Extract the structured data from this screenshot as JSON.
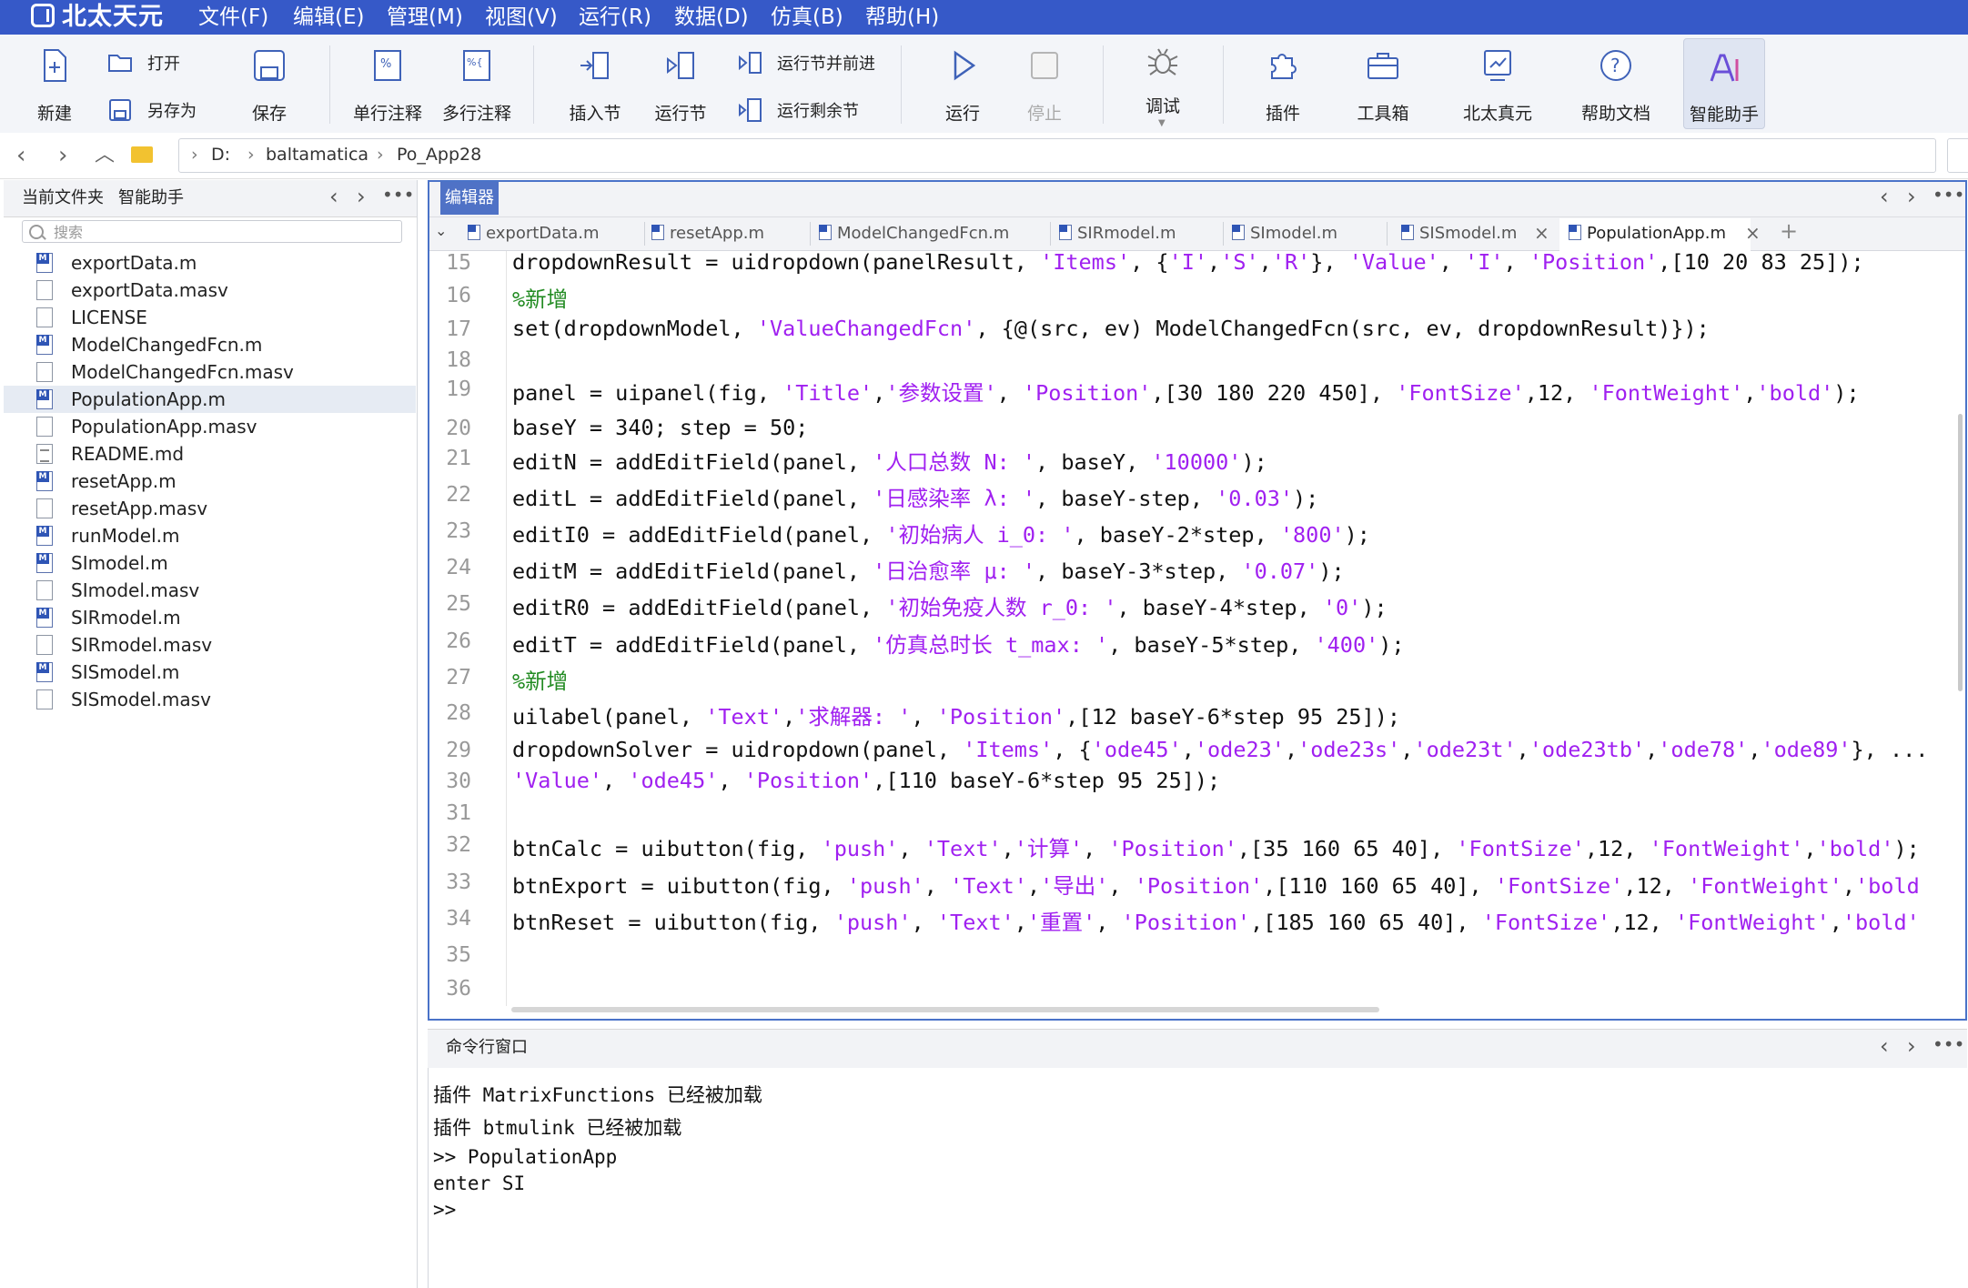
{
  "app": {
    "logo_text": "北太天元"
  },
  "menu": [
    "文件(F)",
    "编辑(E)",
    "管理(M)",
    "视图(V)",
    "运行(R)",
    "数据(D)",
    "仿真(B)",
    "帮助(H)"
  ],
  "toolbar": {
    "new": "新建",
    "open": "打开",
    "save_as": "另存为",
    "save": "保存",
    "comment_line": "单行注释",
    "comment_block": "多行注释",
    "insert_section": "插入节",
    "run_section": "运行节",
    "run_advance": "运行节并前进",
    "run_remaining": "运行剩余节",
    "run": "运行",
    "stop": "停止",
    "debug": "调试",
    "plugins": "插件",
    "toolbox": "工具箱",
    "beitai_zhenyuan": "北太真元",
    "help_docs": "帮助文档",
    "ai_assistant": "智能助手"
  },
  "address": {
    "crumbs": [
      "D:",
      "baltamatica",
      "Po_App28"
    ]
  },
  "left_panel": {
    "tabs": [
      "当前文件夹",
      "智能助手"
    ],
    "search_placeholder": "搜索",
    "files": [
      {
        "name": "exportData.m",
        "type": "m"
      },
      {
        "name": "exportData.masv",
        "type": "file"
      },
      {
        "name": "LICENSE",
        "type": "file"
      },
      {
        "name": "ModelChangedFcn.m",
        "type": "m"
      },
      {
        "name": "ModelChangedFcn.masv",
        "type": "file"
      },
      {
        "name": "PopulationApp.m",
        "type": "m",
        "selected": true
      },
      {
        "name": "PopulationApp.masv",
        "type": "file"
      },
      {
        "name": "README.md",
        "type": "md"
      },
      {
        "name": "resetApp.m",
        "type": "m"
      },
      {
        "name": "resetApp.masv",
        "type": "file"
      },
      {
        "name": "runModel.m",
        "type": "m"
      },
      {
        "name": "SImodel.m",
        "type": "m"
      },
      {
        "name": "SImodel.masv",
        "type": "file"
      },
      {
        "name": "SIRmodel.m",
        "type": "m"
      },
      {
        "name": "SIRmodel.masv",
        "type": "file"
      },
      {
        "name": "SISmodel.m",
        "type": "m"
      },
      {
        "name": "SISmodel.masv",
        "type": "file"
      }
    ]
  },
  "editor": {
    "title": "编辑器",
    "tabs": [
      "exportData.m",
      "resetApp.m",
      "ModelChangedFcn.m",
      "SIRmodel.m",
      "SImodel.m",
      "SISmodel.m",
      "PopulationApp.m"
    ],
    "active_tab": "PopulationApp.m",
    "lines": [
      {
        "n": "15",
        "t": "dropdownResult = uidropdown(panelResult, 'Items', {'I','S','R'}, 'Value', 'I', 'Position',[10 20 83 25]);"
      },
      {
        "n": "16",
        "t": "%新增"
      },
      {
        "n": "17",
        "t": "set(dropdownModel, 'ValueChangedFcn', {@(src, ev) ModelChangedFcn(src, ev, dropdownResult)});"
      },
      {
        "n": "18",
        "t": ""
      },
      {
        "n": "19",
        "t": "panel = uipanel(fig, 'Title','参数设置', 'Position',[30 180 220 450], 'FontSize',12, 'FontWeight','bold');"
      },
      {
        "n": "20",
        "t": "baseY = 340; step = 50;"
      },
      {
        "n": "21",
        "t": "editN = addEditField(panel, '人口总数 N: ', baseY, '10000');"
      },
      {
        "n": "22",
        "t": "editL = addEditField(panel, '日感染率 λ: ', baseY-step, '0.03');"
      },
      {
        "n": "23",
        "t": "editI0 = addEditField(panel, '初始病人 i_0: ', baseY-2*step, '800');"
      },
      {
        "n": "24",
        "t": "editM = addEditField(panel, '日治愈率 μ: ', baseY-3*step, '0.07');"
      },
      {
        "n": "25",
        "t": "editR0 = addEditField(panel, '初始免疫人数 r_0: ', baseY-4*step, '0');"
      },
      {
        "n": "26",
        "t": "editT = addEditField(panel, '仿真总时长 t_max: ', baseY-5*step, '400');"
      },
      {
        "n": "27",
        "t": "%新增"
      },
      {
        "n": "28",
        "t": "uilabel(panel, 'Text','求解器: ', 'Position',[12 baseY-6*step 95 25]);"
      },
      {
        "n": "29",
        "t": "dropdownSolver = uidropdown(panel, 'Items', {'ode45','ode23','ode23s','ode23t','ode23tb','ode78','ode89'}, ..."
      },
      {
        "n": "30",
        "t": "'Value', 'ode45', 'Position',[110 baseY-6*step 95 25]);"
      },
      {
        "n": "31",
        "t": ""
      },
      {
        "n": "32",
        "t": "btnCalc = uibutton(fig, 'push', 'Text','计算', 'Position',[35 160 65 40], 'FontSize',12, 'FontWeight','bold');"
      },
      {
        "n": "33",
        "t": "btnExport = uibutton(fig, 'push', 'Text','导出', 'Position',[110 160 65 40], 'FontSize',12, 'FontWeight','bold"
      },
      {
        "n": "34",
        "t": "btnReset = uibutton(fig, 'push', 'Text','重置', 'Position',[185 160 65 40], 'FontSize',12, 'FontWeight','bold'"
      },
      {
        "n": "35",
        "t": ""
      },
      {
        "n": "36",
        "t": ""
      }
    ]
  },
  "command_window": {
    "title": "命令行窗口",
    "lines": [
      "插件 MatrixFunctions 已经被加载",
      "插件 btmulink 已经被加载",
      ">> PopulationApp",
      "enter SI",
      ">>"
    ]
  },
  "colors": {
    "menubar": "#3659c8",
    "accent": "#4f72c6",
    "string": "#a020f0",
    "comment": "#228b22"
  }
}
